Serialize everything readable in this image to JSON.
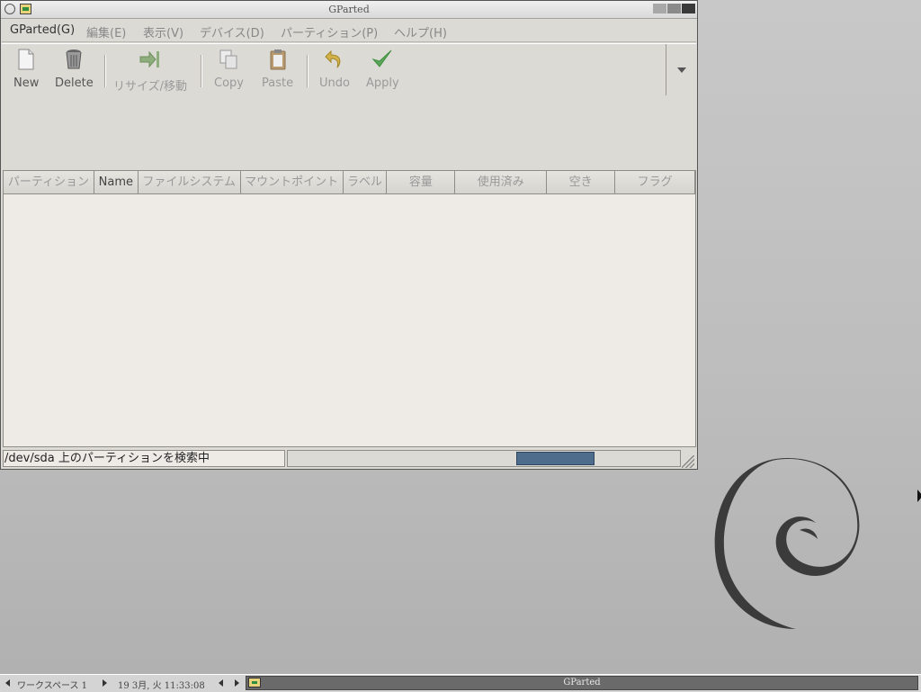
{
  "window": {
    "title": "GParted"
  },
  "menubar": {
    "items": [
      "GParted(G)",
      "編集(E)",
      "表示(V)",
      "デバイス(D)",
      "パーティション(P)",
      "ヘルプ(H)"
    ]
  },
  "toolbar": {
    "new_label": "New",
    "delete_label": "Delete",
    "resize_label": "リサイズ/移動",
    "copy_label": "Copy",
    "paste_label": "Paste",
    "undo_label": "Undo",
    "apply_label": "Apply"
  },
  "table": {
    "columns": [
      "パーティション",
      "Name",
      "ファイルシステム",
      "マウントポイント",
      "ラベル",
      "容量",
      "使用済み",
      "空き",
      "フラグ"
    ],
    "rows": []
  },
  "status": {
    "text": "/dev/sda 上のパーティションを検索中"
  },
  "taskbar": {
    "workspace": "ワークスペース 1",
    "clock": "19  3月, 火 11:33:08",
    "task_name": "GParted"
  },
  "colors": {
    "progress_fill": "#4e6d8c",
    "apply_check": "#3f8f3f"
  },
  "icons": {
    "new": "document-icon",
    "delete": "trash-can-icon",
    "resize": "resize-arrow-icon",
    "copy": "copy-icon",
    "paste": "paste-icon",
    "undo": "undo-icon",
    "apply": "checkmark-icon"
  }
}
